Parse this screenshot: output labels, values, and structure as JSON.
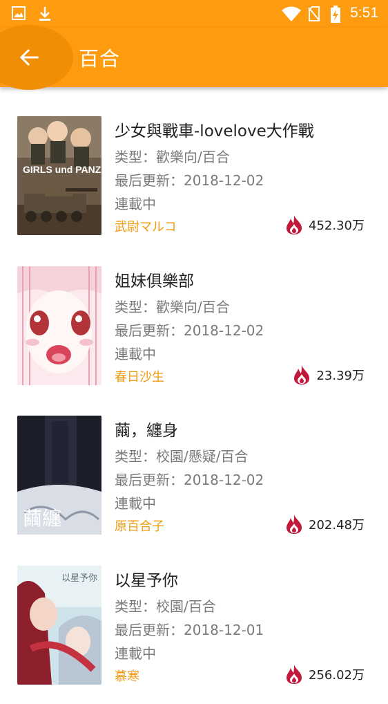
{
  "status_bar": {
    "time": "5:51",
    "left_icons": [
      "image-icon",
      "download-icon"
    ],
    "right_icons": [
      "wifi-icon",
      "no-sim-icon",
      "battery-charging-icon"
    ]
  },
  "toolbar": {
    "title": "百合",
    "back_icon": "arrow-back-icon"
  },
  "colors": {
    "accent": "#ff9b0f",
    "author": "#f29a10",
    "flame": "#c2183a"
  },
  "comics": [
    {
      "title": "少女與戰車-lovelove大作戰",
      "genre": "类型：歡樂向/百合",
      "updated": "最后更新：2018-12-02",
      "status": "連載中",
      "author": "武尉マルコ",
      "popularity": "452.30万",
      "cover_text": "GIRLS und PANZER"
    },
    {
      "title": "姐妹俱樂部",
      "genre": "类型：歡樂向/百合",
      "updated": "最后更新：2018-12-02",
      "status": "連載中",
      "author": "春日沙生",
      "popularity": "23.39万"
    },
    {
      "title": "繭，纏身",
      "genre": "类型：校園/懸疑/百合",
      "updated": "最后更新：2018-12-02",
      "status": "連載中",
      "author": "原百合子",
      "popularity": "202.48万",
      "cover_text": "繭纏"
    },
    {
      "title": "以星予你",
      "genre": "类型：校園/百合",
      "updated": "最后更新：2018-12-01",
      "status": "連載中",
      "author": "慕寒",
      "popularity": "256.02万",
      "cover_text": "以星予你"
    }
  ]
}
